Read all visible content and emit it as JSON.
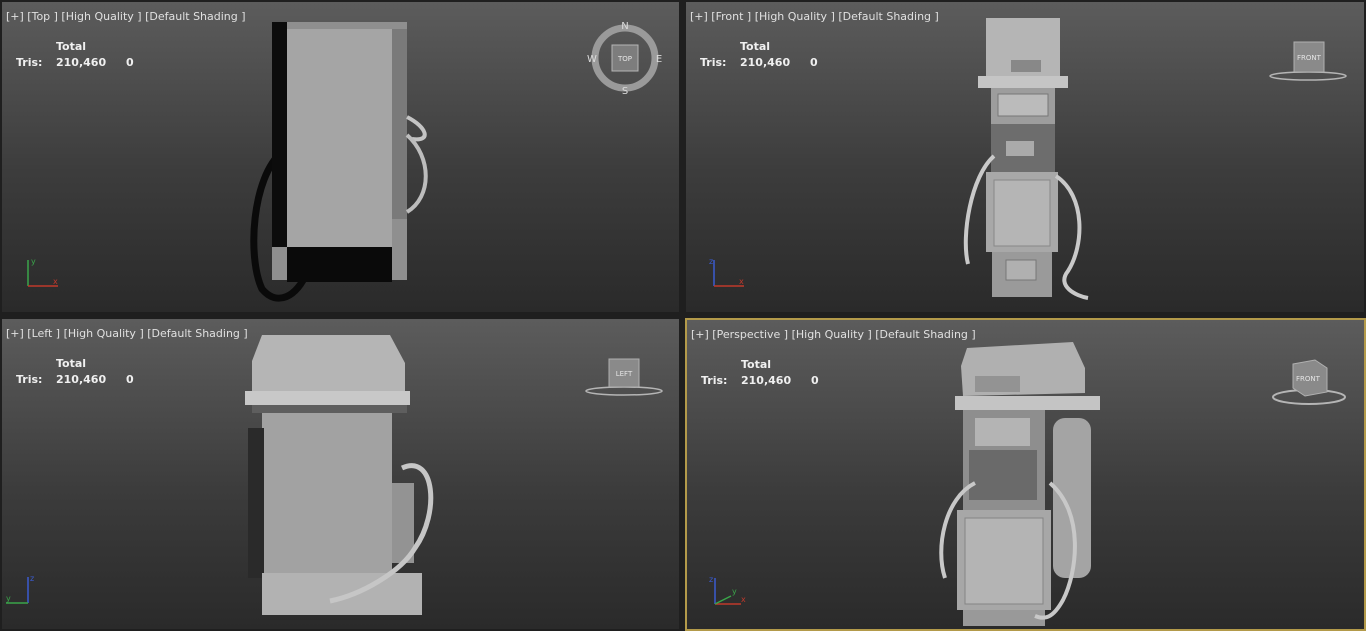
{
  "viewports": {
    "top": {
      "label": "[+] [Top ] [High Quality ] [Default Shading ]",
      "total_label": "Total",
      "tris_label": "Tris:",
      "tris_value": "210,460",
      "tris_selected": "0",
      "compass": {
        "n": "N",
        "s": "S",
        "e": "E",
        "w": "W",
        "cube": "TOP"
      }
    },
    "front": {
      "label": "[+] [Front ] [High Quality ] [Default Shading ]",
      "total_label": "Total",
      "tris_label": "Tris:",
      "tris_value": "210,460",
      "tris_selected": "0",
      "cube": "FRONT"
    },
    "left": {
      "label": "[+] [Left ] [High Quality ] [Default Shading ]",
      "total_label": "Total",
      "tris_label": "Tris:",
      "tris_value": "210,460",
      "tris_selected": "0",
      "cube": "LEFT"
    },
    "perspective": {
      "label": "[+] [Perspective ] [High Quality ] [Default Shading ]",
      "total_label": "Total",
      "tris_label": "Tris:",
      "tris_value": "210,460",
      "tris_selected": "0",
      "cube": "FRONT"
    }
  },
  "axis_labels": {
    "x": "x",
    "y": "y",
    "z": "z"
  },
  "colors": {
    "active_border": "#b39a4a",
    "axis_x": "#c0392b",
    "axis_y": "#3aa54a",
    "axis_z": "#3a5bd0"
  }
}
